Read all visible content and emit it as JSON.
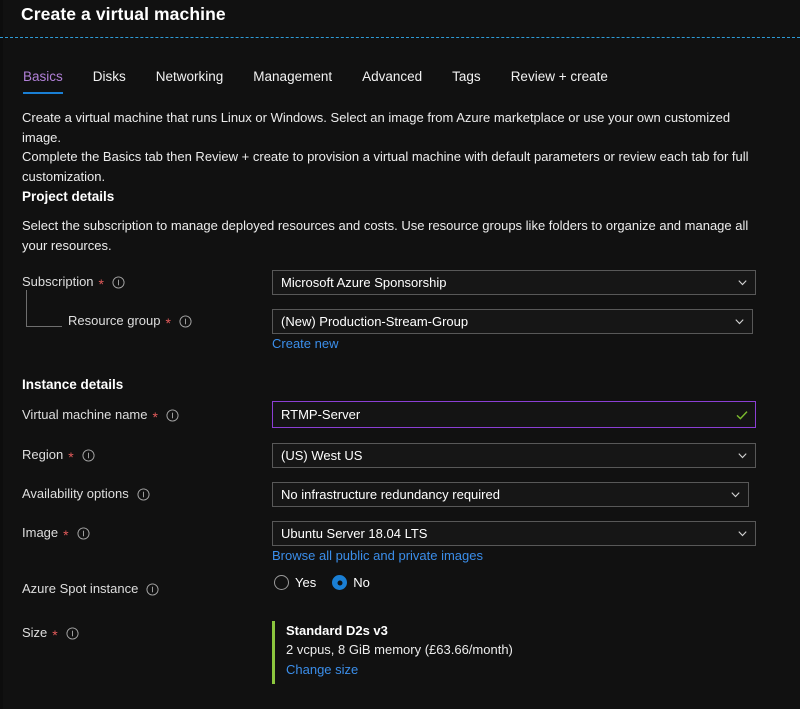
{
  "header": {
    "title": "Create a virtual machine"
  },
  "tabs": [
    {
      "label": "Basics",
      "active": true
    },
    {
      "label": "Disks",
      "active": false
    },
    {
      "label": "Networking",
      "active": false
    },
    {
      "label": "Management",
      "active": false
    },
    {
      "label": "Advanced",
      "active": false
    },
    {
      "label": "Tags",
      "active": false
    },
    {
      "label": "Review + create",
      "active": false
    }
  ],
  "intro": {
    "line1": "Create a virtual machine that runs Linux or Windows. Select an image from Azure marketplace or use your own customized image.",
    "line2": "Complete the Basics tab then Review + create to provision a virtual machine with default parameters or review each tab for full customization."
  },
  "project_details": {
    "heading": "Project details",
    "description": "Select the subscription to manage deployed resources and costs. Use resource groups like folders to organize and manage all your resources.",
    "subscription": {
      "label": "Subscription",
      "required": "*",
      "value": "Microsoft Azure Sponsorship"
    },
    "resource_group": {
      "label": "Resource group",
      "required": "*",
      "value": "(New) Production-Stream-Group",
      "create_new_link": "Create new"
    }
  },
  "instance_details": {
    "heading": "Instance details",
    "vm_name": {
      "label": "Virtual machine name",
      "required": "*",
      "value": "RTMP-Server"
    },
    "region": {
      "label": "Region",
      "required": "*",
      "value": "(US) West US"
    },
    "availability_options": {
      "label": "Availability options",
      "value": "No infrastructure redundancy required"
    },
    "image": {
      "label": "Image",
      "required": "*",
      "value": "Ubuntu Server 18.04 LTS",
      "browse_link": "Browse all public and private images"
    },
    "azure_spot": {
      "label": "Azure Spot instance",
      "options": [
        {
          "label": "Yes",
          "selected": false
        },
        {
          "label": "No",
          "selected": true
        }
      ]
    },
    "size": {
      "label": "Size",
      "required": "*",
      "name": "Standard D2s v3",
      "specs": "2 vcpus, 8 GiB memory (£63.66/month)",
      "change_link": "Change size"
    }
  },
  "colors": {
    "background": "#111111",
    "accent_blue": "#1a7fd4",
    "link_blue": "#3b8eea",
    "active_tab_purple": "#b180d7",
    "focus_purple": "#8b3fd4",
    "required_red": "#e35b5b",
    "valid_green": "#8cc63e",
    "rule_blue": "#2e9bd6"
  }
}
